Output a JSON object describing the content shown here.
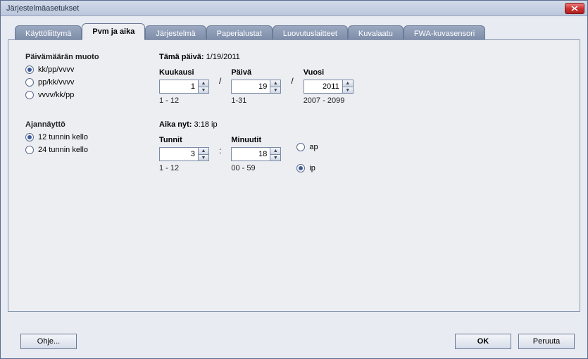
{
  "window": {
    "title": "Järjestelmäasetukset"
  },
  "tabs": [
    {
      "label": "Käyttöliittymä"
    },
    {
      "label": "Pvm ja aika"
    },
    {
      "label": "Järjestelmä"
    },
    {
      "label": "Paperialustat"
    },
    {
      "label": "Luovutuslaitteet"
    },
    {
      "label": "Kuvalaatu"
    },
    {
      "label": "FWA-kuvasensori"
    }
  ],
  "date": {
    "section_label": "Päivämäärän muoto",
    "formats": [
      "kk/pp/vvvv",
      "pp/kk/vvvv",
      "vvvv/kk/pp"
    ],
    "today_label": "Tämä päivä:",
    "today_value": "1/19/2011",
    "month_label": "Kuukausi",
    "day_label": "Päivä",
    "year_label": "Vuosi",
    "month": "1",
    "day": "19",
    "year": "2011",
    "month_range": "1 - 12",
    "day_range": "1-31",
    "year_range": "2007 - 2099",
    "sep": "/"
  },
  "time": {
    "section_label": "Ajannäyttö",
    "clock_options": [
      "12 tunnin kello",
      "24 tunnin kello"
    ],
    "now_label": "Aika nyt:",
    "now_value": "3:18 ip",
    "hours_label": "Tunnit",
    "minutes_label": "Minuutit",
    "hours": "3",
    "minutes": "18",
    "hours_range": "1 - 12",
    "minutes_range": "00 - 59",
    "ampm": [
      "ap",
      "ip"
    ],
    "sep": ":"
  },
  "buttons": {
    "help": "Ohje...",
    "ok": "OK",
    "cancel": "Peruuta"
  }
}
